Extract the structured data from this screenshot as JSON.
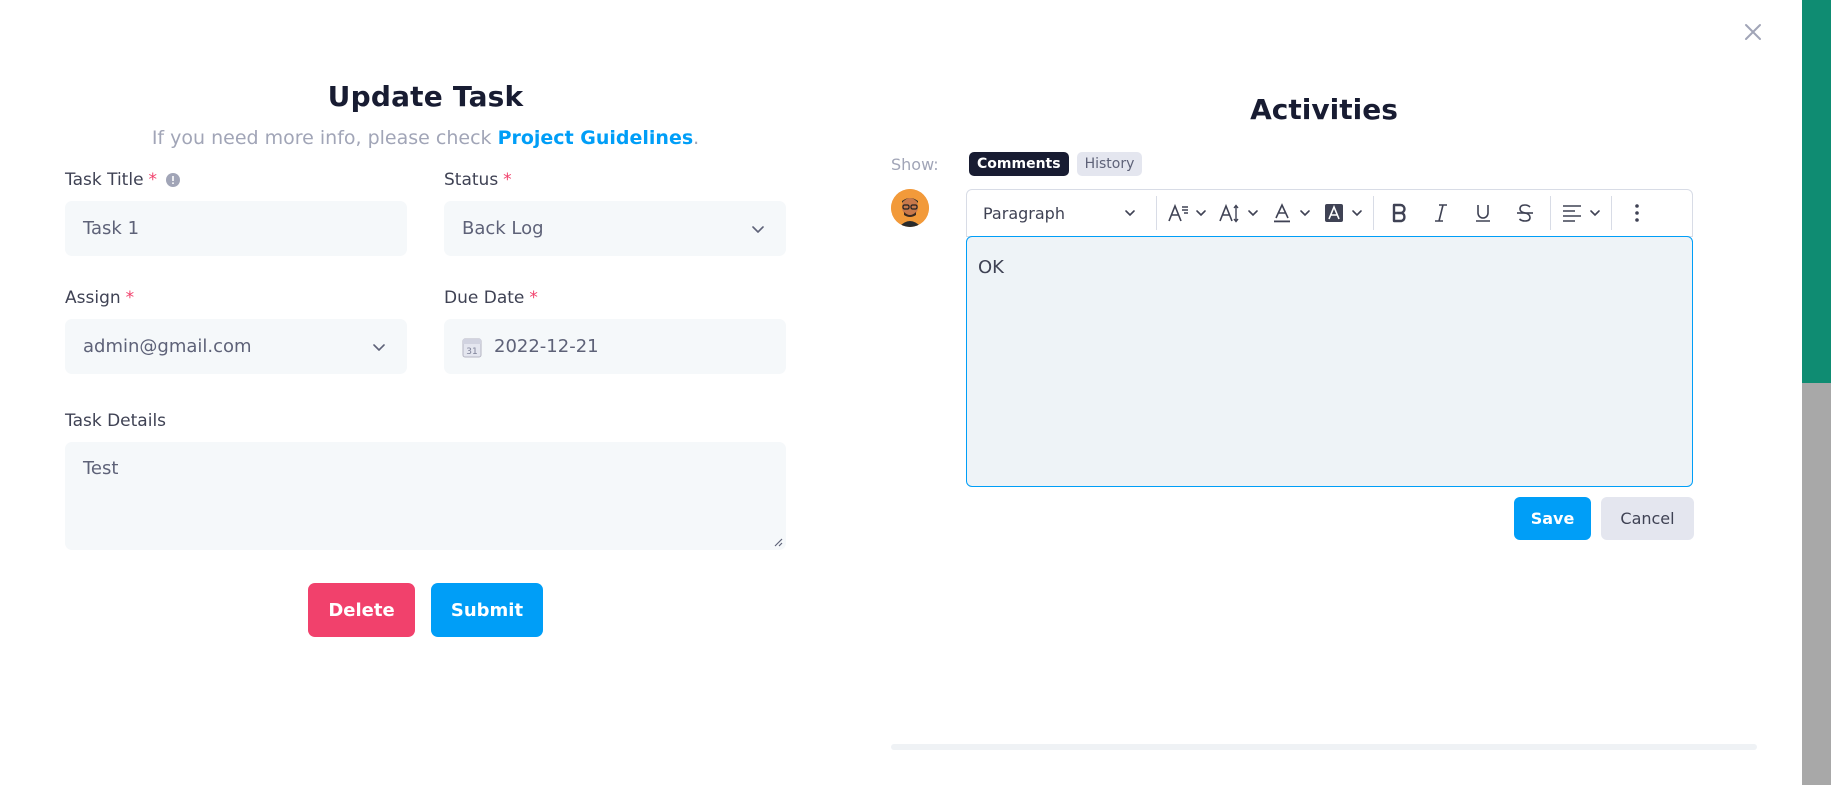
{
  "modal": {
    "close_icon": "close-icon"
  },
  "form": {
    "title": "Update Task",
    "subtitle_prefix": "If you need more info, please check ",
    "subtitle_link": "Project Guidelines",
    "subtitle_suffix": ".",
    "task_title": {
      "label": "Task Title",
      "required": "*",
      "value": "Task 1"
    },
    "status": {
      "label": "Status",
      "required": "*",
      "value": "Back Log"
    },
    "assign": {
      "label": "Assign",
      "required": "*",
      "value": "admin@gmail.com"
    },
    "due_date": {
      "label": "Due Date",
      "required": "*",
      "value": "2022-12-21",
      "calendar_day": "31"
    },
    "task_details": {
      "label": "Task Details",
      "value": "Test"
    },
    "delete_label": "Delete",
    "submit_label": "Submit"
  },
  "activities": {
    "title": "Activities",
    "show_label": "Show:",
    "tabs": [
      {
        "label": "Comments",
        "active": true
      },
      {
        "label": "History",
        "active": false
      }
    ],
    "editor": {
      "paragraph_label": "Paragraph",
      "content": "OK",
      "toolbar_icons": [
        "font-family-icon",
        "font-size-icon",
        "font-color-icon",
        "highlight-icon",
        "bold-icon",
        "italic-icon",
        "underline-icon",
        "strikethrough-icon",
        "align-left-icon",
        "more-vertical-icon"
      ]
    },
    "save_label": "Save",
    "cancel_label": "Cancel"
  },
  "colors": {
    "primary": "#009ef7",
    "danger": "#f1416c",
    "dark": "#181c32",
    "muted": "#a1a5b7",
    "input_bg": "#f5f8fa"
  }
}
